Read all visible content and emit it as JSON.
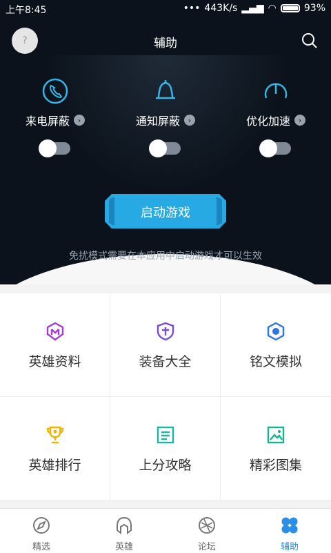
{
  "status": {
    "time": "上午8:45",
    "network": "443K/s",
    "battery": "93%"
  },
  "header": {
    "title": "辅助"
  },
  "features": [
    {
      "label": "来电屏蔽",
      "icon": "phone-icon",
      "enabled": false
    },
    {
      "label": "通知屏蔽",
      "icon": "bell-icon",
      "enabled": false
    },
    {
      "label": "优化加速",
      "icon": "speed-gauge-icon",
      "enabled": false
    }
  ],
  "launch": {
    "label": "启动游戏",
    "note": "免扰模式需要在本应用中启动游戏才可以生效"
  },
  "grid": [
    {
      "label": "英雄资料",
      "icon": "hero-helmet-icon",
      "color": "#a23cd8"
    },
    {
      "label": "装备大全",
      "icon": "shield-cross-icon",
      "color": "#7a4bd6"
    },
    {
      "label": "铭文模拟",
      "icon": "hexagon-gem-icon",
      "color": "#2f74e6"
    },
    {
      "label": "英雄排行",
      "icon": "trophy-icon",
      "color": "#f0b400"
    },
    {
      "label": "上分攻略",
      "icon": "document-icon",
      "color": "#1bb3a4"
    },
    {
      "label": "精彩图集",
      "icon": "gallery-icon",
      "color": "#18b08f"
    }
  ],
  "nav": [
    {
      "label": "精选",
      "icon": "compass-icon"
    },
    {
      "label": "英雄",
      "icon": "helmet-icon"
    },
    {
      "label": "论坛",
      "icon": "forum-icon"
    },
    {
      "label": "辅助",
      "icon": "grid-clover-icon",
      "active": true
    }
  ],
  "colors": {
    "accent": "#2b8fe6",
    "dark_bg": "#0b121b",
    "cyan": "#35b6e8"
  }
}
